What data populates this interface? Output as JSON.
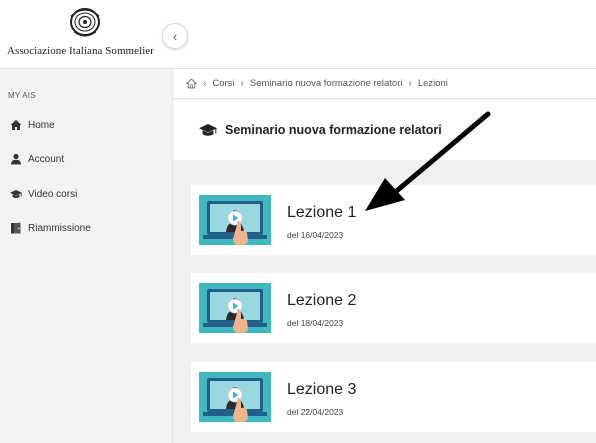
{
  "brand": {
    "name": "Associazione Italiana Sommelier"
  },
  "sidebar": {
    "section_title": "MY AIS",
    "items": [
      {
        "label": "Home",
        "icon": "home-icon"
      },
      {
        "label": "Account",
        "icon": "user-icon"
      },
      {
        "label": "Video corsi",
        "icon": "graduation-cap-icon"
      },
      {
        "label": "Riammissione",
        "icon": "door-icon"
      }
    ]
  },
  "breadcrumb": {
    "items": [
      "Corsi",
      "Seminario nuova formazione relatori",
      "Lezioni"
    ]
  },
  "course": {
    "title": "Seminario nuova formazione relatori"
  },
  "lessons": [
    {
      "title": "Lezione 1",
      "date": "del 16/04/2023"
    },
    {
      "title": "Lezione 2",
      "date": "del 18/04/2023"
    },
    {
      "title": "Lezione 3",
      "date": "del 22/04/2023"
    }
  ],
  "colors": {
    "thumb_teal": "#3fb8c2",
    "arrow": "#000000"
  }
}
